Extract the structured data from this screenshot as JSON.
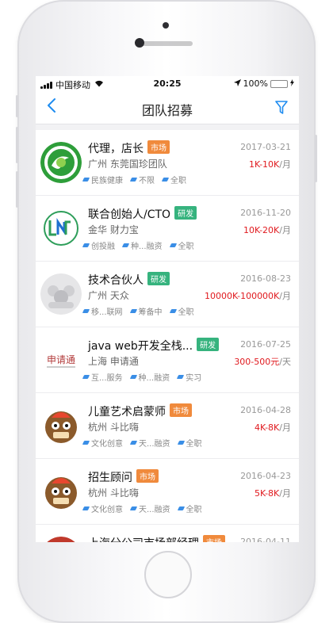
{
  "status": {
    "carrier": "中国移动",
    "time": "20:25",
    "battery": "100%",
    "battery_level": 1.0
  },
  "nav": {
    "title": "团队招募",
    "back_icon": "chevron-left-icon",
    "filter_icon": "filter-icon"
  },
  "colors": {
    "accent": "#1e8cf0",
    "tag_market": "#f08a3c",
    "tag_dev": "#36b37e",
    "salary": "#e0191e"
  },
  "jobs": [
    {
      "title": "代理，店长",
      "tag": "市场",
      "tag_type": "market",
      "company": "广州  东莞国珍团队",
      "date": "2017-03-21",
      "salary": "1K-10K",
      "unit": "/月",
      "labels": [
        "民族健康",
        "不限",
        "全职"
      ]
    },
    {
      "title": "联合创始人/CTO",
      "tag": "研发",
      "tag_type": "dev",
      "company": "金华  财力宝",
      "date": "2016-11-20",
      "salary": "10K-20K",
      "unit": "/月",
      "labels": [
        "创投融",
        "种...融资",
        "全职"
      ]
    },
    {
      "title": "技术合伙人",
      "tag": "研发",
      "tag_type": "dev",
      "company": "广州  天众",
      "date": "2016-08-23",
      "salary": "10000K-100000K",
      "unit": "/月",
      "labels": [
        "移...联网",
        "筹备中",
        "全职"
      ]
    },
    {
      "title": "java web开发全栈...",
      "tag": "研发",
      "tag_type": "dev",
      "company": "上海  申请通",
      "date": "2016-07-25",
      "salary": "300-500元",
      "unit": "/天",
      "labels": [
        "互...服务",
        "种...融资",
        "实习"
      ]
    },
    {
      "title": "儿童艺术启蒙师",
      "tag": "市场",
      "tag_type": "market",
      "company": "杭州  斗比嗨",
      "date": "2016-04-28",
      "salary": "4K-8K",
      "unit": "/月",
      "labels": [
        "文化创意",
        "天...融资",
        "全职"
      ]
    },
    {
      "title": "招生顾问",
      "tag": "市场",
      "tag_type": "market",
      "company": "杭州  斗比嗨",
      "date": "2016-04-23",
      "salary": "5K-8K",
      "unit": "/月",
      "labels": [
        "文化创意",
        "天...融资",
        "全职"
      ]
    },
    {
      "title": "上海分公司市场部经理",
      "tag": "市场",
      "tag_type": "market",
      "company": "",
      "date": "2016-04-11",
      "salary": "",
      "unit": "",
      "labels": []
    }
  ]
}
